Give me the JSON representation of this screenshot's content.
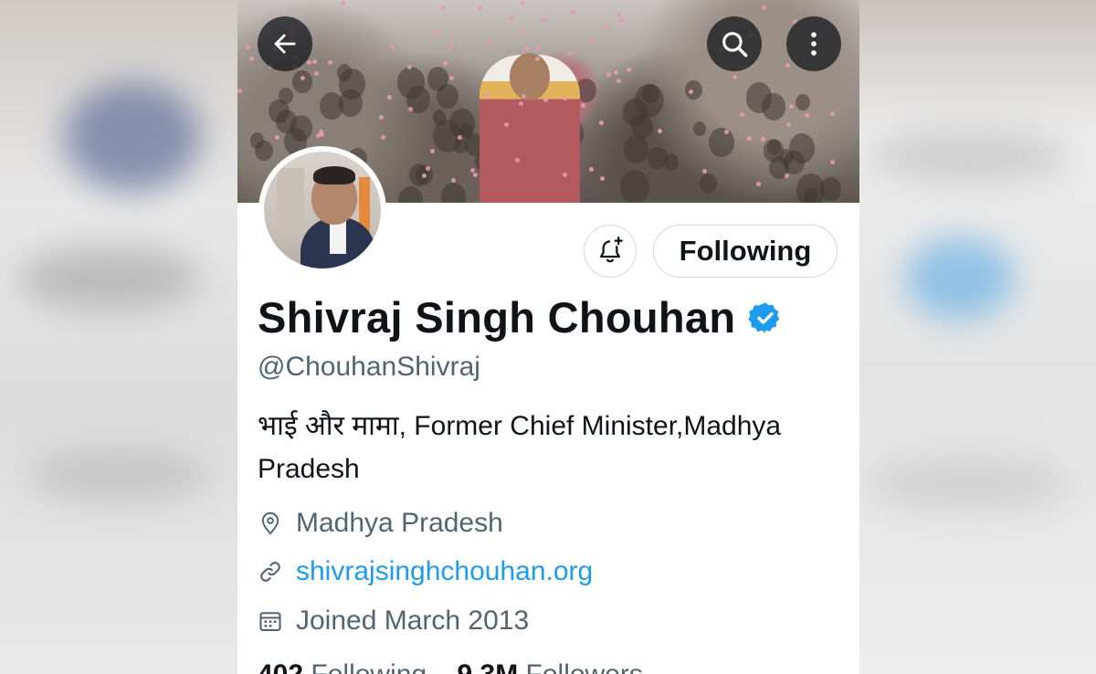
{
  "profile": {
    "name": "Shivraj Singh Chouhan",
    "handle": "@ChouhanShivraj",
    "bio": "भाई और मामा, Former Chief Minister,Madhya Pradesh",
    "location": "Madhya Pradesh",
    "website": "shivrajsinghchouhan.org",
    "joined": "Joined March 2013"
  },
  "actions": {
    "following_label": "Following"
  },
  "stats": {
    "following_count": "402",
    "following_label": "Following",
    "followers_count": "9.3M",
    "followers_label": "Followers"
  },
  "icons": {
    "back": "arrow-left-icon",
    "search": "search-icon",
    "more": "more-vertical-icon",
    "notify": "bell-plus-icon",
    "verified": "verified-badge-icon",
    "location": "location-pin-icon",
    "link": "link-icon",
    "calendar": "calendar-icon"
  },
  "colors": {
    "accent": "#1d9bf0",
    "text_primary": "#0f1419",
    "text_secondary": "#536471"
  }
}
